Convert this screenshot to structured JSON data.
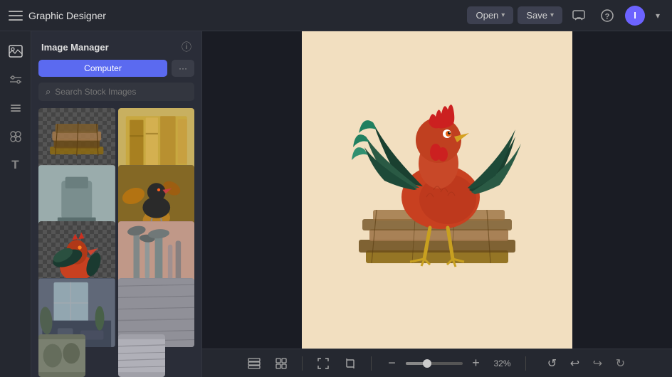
{
  "app": {
    "title": "Graphic Designer"
  },
  "topbar": {
    "open_label": "Open",
    "save_label": "Save",
    "avatar_letter": "I"
  },
  "panel": {
    "title": "Image Manager",
    "computer_tab": "Computer",
    "search_placeholder": "Search Stock Images"
  },
  "zoom": {
    "value": "32%"
  },
  "icons": {
    "hamburger": "☰",
    "message": "💬",
    "help": "?",
    "chevron_down": "▾",
    "images": "🖼",
    "filters": "⚙",
    "layers": "▤",
    "elements": "◎",
    "text": "T",
    "info": "ⓘ",
    "more": "…",
    "search": "⌕",
    "layers_bottom": "⊞",
    "grid": "⊞",
    "zoom_out": "−",
    "zoom_in": "+",
    "fit": "⤢",
    "crop": "⊡",
    "undo": "↩",
    "redo": "↪",
    "refresh": "↺",
    "forward": "↻"
  }
}
